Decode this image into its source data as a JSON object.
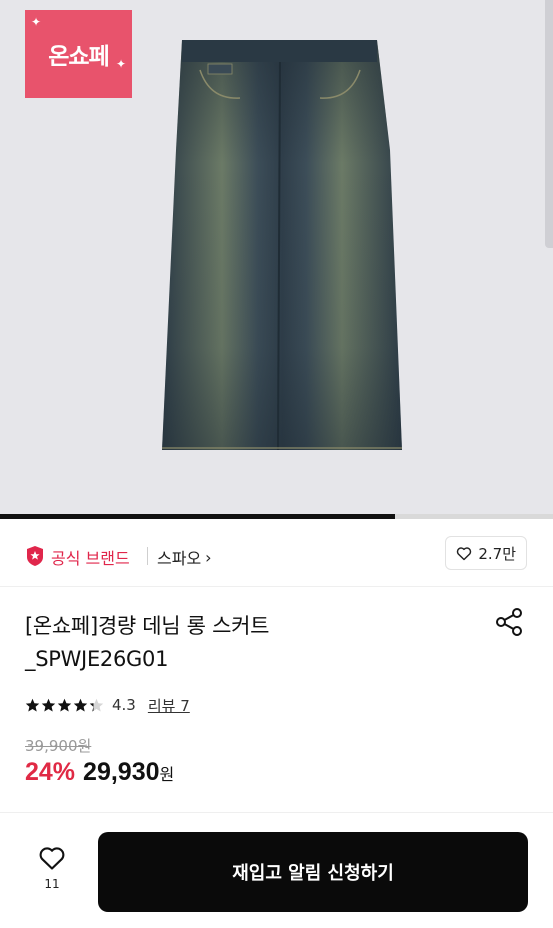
{
  "hero": {
    "badge_text": "온쇼페",
    "progress_fraction": 0.715
  },
  "brand": {
    "official_label": "공식 브랜드",
    "shop_name": "스파오",
    "shop_chevron": "›",
    "like_count": "2.7만"
  },
  "product": {
    "title_line1": "[온쇼페]경량 데님 롱 스커트",
    "title_line2": "_SPWJE26G01"
  },
  "rating": {
    "stars_value": 4.3,
    "value": "4.3",
    "review_label": "리뷰 7"
  },
  "price": {
    "original": "39,900원",
    "discount": "24%",
    "sale": "29,930",
    "currency": "원"
  },
  "bottom_bar": {
    "wish_count": "11",
    "cta_label": "재입고 알림 신청하기"
  },
  "colors": {
    "accent_red": "#e0264b",
    "badge_pink": "#e8536c",
    "cta_black": "#0a0a0a"
  },
  "icons": [
    "heart-icon",
    "share-icon",
    "official-brand-icon",
    "star-icon"
  ]
}
